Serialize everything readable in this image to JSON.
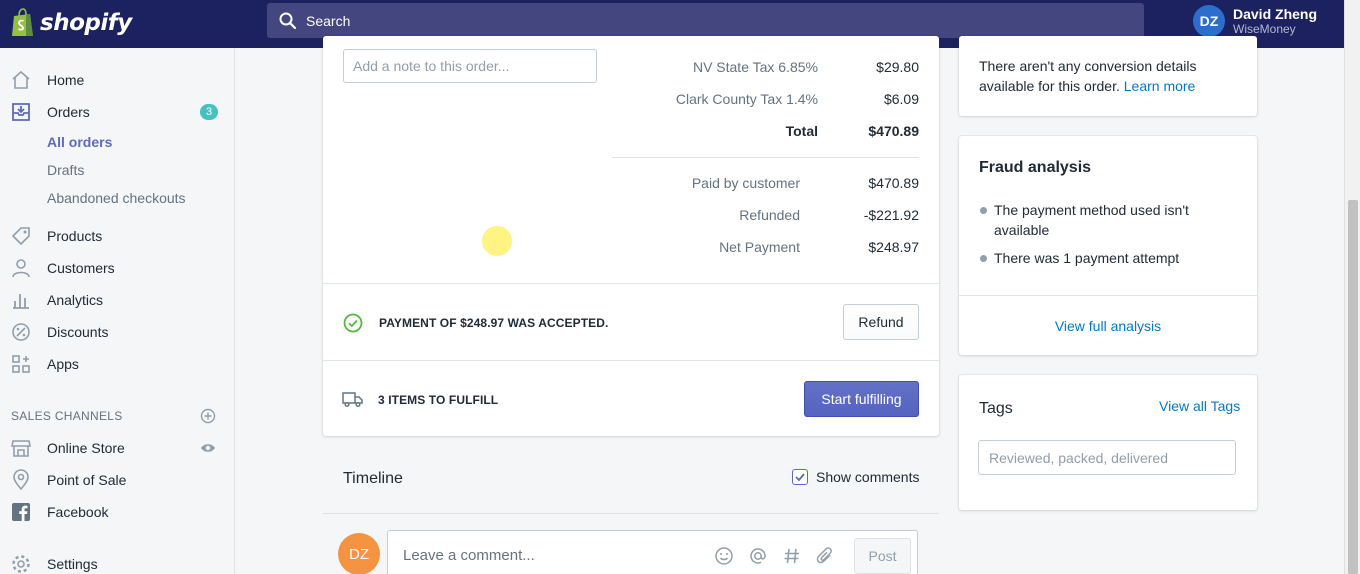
{
  "topbar": {
    "brand": "shopify",
    "search_placeholder": "Search",
    "user_initials": "DZ",
    "user_name": "David Zheng",
    "user_store": "WiseMoney"
  },
  "sidebar": {
    "home": "Home",
    "orders": "Orders",
    "orders_badge": "3",
    "all_orders": "All orders",
    "drafts": "Drafts",
    "abandoned": "Abandoned checkouts",
    "products": "Products",
    "customers": "Customers",
    "analytics": "Analytics",
    "discounts": "Discounts",
    "apps": "Apps",
    "sales_channels": "SALES CHANNELS",
    "online_store": "Online Store",
    "point_of_sale": "Point of Sale",
    "facebook": "Facebook",
    "settings": "Settings"
  },
  "order": {
    "note_placeholder": "Add a note to this order...",
    "nv_tax_label": "NV State Tax 6.85%",
    "nv_tax_value": "$29.80",
    "clark_tax_label": "Clark County Tax 1.4%",
    "clark_tax_value": "$6.09",
    "total_label": "Total",
    "total_value": "$470.89",
    "paid_label": "Paid by customer",
    "paid_value": "$470.89",
    "refunded_label": "Refunded",
    "refunded_value": "-$221.92",
    "net_label": "Net Payment",
    "net_value": "$248.97",
    "payment_status": "PAYMENT OF $248.97 WAS ACCEPTED.",
    "refund_button": "Refund",
    "fulfill_status": "3 ITEMS TO FULFILL",
    "start_fulfilling": "Start fulfilling"
  },
  "timeline": {
    "title": "Timeline",
    "show_comments": "Show comments",
    "avatar_initials": "DZ",
    "comment_placeholder": "Leave a comment...",
    "post_button": "Post"
  },
  "right": {
    "conversion_text": "There aren't any conversion details available for this order.",
    "learn_more": "Learn more",
    "fraud_title": "Fraud analysis",
    "fraud_item_1": "The payment method used isn't available",
    "fraud_item_2": "There was 1 payment attempt",
    "view_full_analysis": "View full analysis",
    "tags_title": "Tags",
    "view_all_tags": "View all Tags",
    "tags_placeholder": "Reviewed, packed, delivered"
  },
  "colors": {
    "topbar": "#1c2260",
    "primary": "#5c6ac4",
    "link": "#007ace",
    "badge": "#47c1bf",
    "success": "#50b83c",
    "avatar_orange": "#f49342"
  }
}
